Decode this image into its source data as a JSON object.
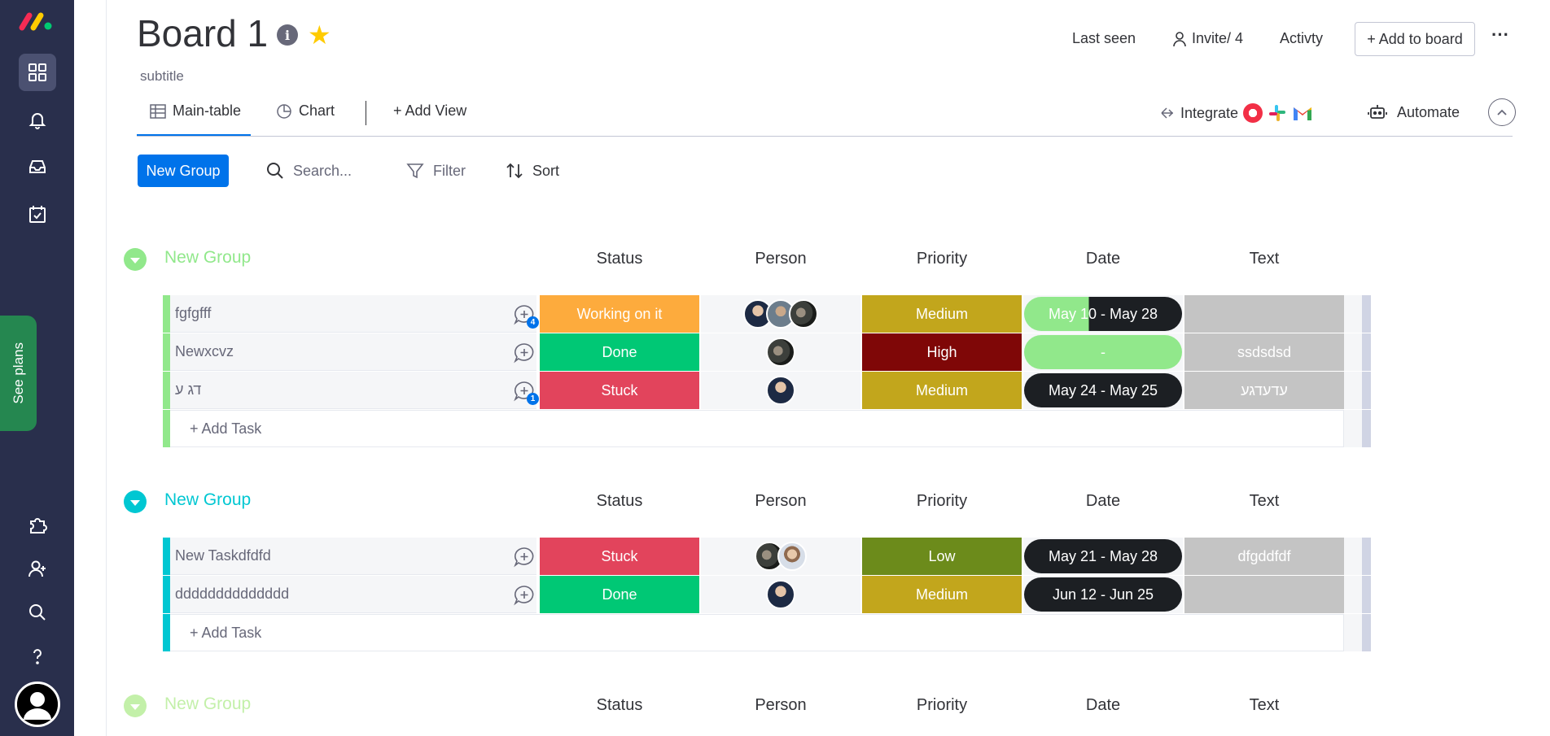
{
  "header": {
    "board_title": "Board 1",
    "subtitle": "subtitle",
    "last_seen": "Last seen",
    "invite": "Invite/ 4",
    "activity": "Activty",
    "add_to_board": "+ Add to board",
    "more": "···"
  },
  "sidebar": {
    "see_plans": "See plans",
    "icons": [
      "workspaces-icon",
      "notifications-icon",
      "inbox-icon",
      "my-work-icon",
      "apps-icon",
      "invite-members-icon",
      "search-icon",
      "help-icon"
    ]
  },
  "tabs": {
    "main_table": "Main-table",
    "chart": "Chart",
    "add_view": "+ Add View",
    "integrate": "Integrate",
    "automate": "Automate"
  },
  "toolbar": {
    "new_group": "New Group",
    "search_placeholder": "Search...",
    "filter": "Filter",
    "sort": "Sort"
  },
  "columns": [
    "Status",
    "Person",
    "Priority",
    "Date",
    "Text"
  ],
  "colors": {
    "working": "#fdab3d",
    "done": "#00c875",
    "stuck": "#e2445c",
    "medium": "#c2a61c",
    "high": "#7f0707",
    "low": "#6c8b1b",
    "group_green": "#9cd326",
    "group_cyan": "#00c7d2"
  },
  "groups": [
    {
      "title": "New Group",
      "rows": [
        {
          "name": "fgfgfff",
          "badge": "4",
          "status": "Working on it",
          "priority": "Medium",
          "date": "May 10 - May 28",
          "text": ""
        },
        {
          "name": "Newxcvz",
          "badge": "",
          "status": "Done",
          "priority": "High",
          "date": "-",
          "text": "ssdsdsd"
        },
        {
          "name": "דג ע",
          "badge": "1",
          "status": "Stuck",
          "priority": "Medium",
          "date": "May 24 - May 25",
          "text": "עדעדגע"
        }
      ],
      "add_task": "+ Add Task"
    },
    {
      "title": "New Group",
      "rows": [
        {
          "name": "New Taskdfdfd",
          "badge": "",
          "status": "Stuck",
          "priority": "Low",
          "date": "May 21 - May 28",
          "text": "dfgddfdf"
        },
        {
          "name": "dddddddddddddd",
          "badge": "",
          "status": "Done",
          "priority": "Medium",
          "date": "Jun 12 - Jun 25",
          "text": ""
        }
      ],
      "add_task": "+ Add Task"
    },
    {
      "title": "New Group",
      "rows": [],
      "add_task": ""
    }
  ]
}
